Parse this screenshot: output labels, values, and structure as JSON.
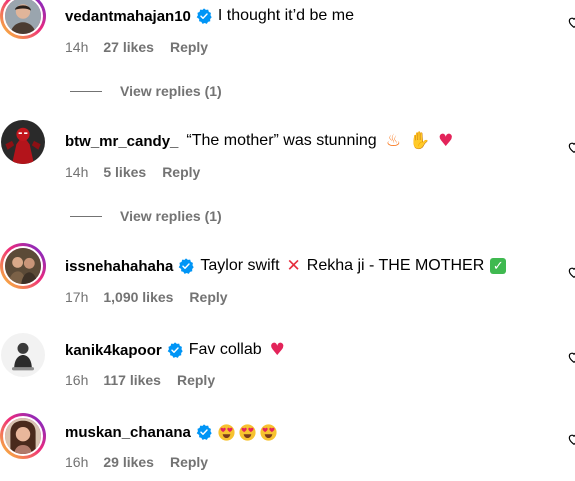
{
  "comments": [
    {
      "username": "vedantmahajan10",
      "verified": true,
      "text": "I thought it’d be me",
      "emojis": [],
      "time": "14h",
      "likes": "27 likes",
      "reply": "Reply",
      "view_replies": "View replies (1)"
    },
    {
      "username": "btw_mr_candy_",
      "verified": false,
      "text": "“The mother” was stunning",
      "emojis": [
        "fire-emoji",
        "raised-hands-emoji",
        "heart-emoji"
      ],
      "time": "14h",
      "likes": "5 likes",
      "reply": "Reply",
      "view_replies": "View replies (1)"
    },
    {
      "username": "issnehahahaha",
      "verified": true,
      "text_a": "Taylor swift",
      "text_b": "Rekha ji - THE MOTHER",
      "emojis": [
        "cross-mark-emoji",
        "check-mark-emoji"
      ],
      "time": "17h",
      "likes": "1,090 likes",
      "reply": "Reply"
    },
    {
      "username": "kanik4kapoor",
      "verified": true,
      "text": "Fav collab",
      "emojis": [
        "heart-emoji"
      ],
      "time": "16h",
      "likes": "117 likes",
      "reply": "Reply"
    },
    {
      "username": "muskan_chanana",
      "verified": true,
      "text": "",
      "emojis": [
        "heart-eyes-emoji",
        "heart-eyes-emoji",
        "heart-eyes-emoji"
      ],
      "time": "16h",
      "likes": "29 likes",
      "reply": "Reply"
    }
  ],
  "colors": {
    "verified_blue": "#0095f6",
    "meta_gray": "#737373",
    "story_ring": "#ee2a7b"
  }
}
